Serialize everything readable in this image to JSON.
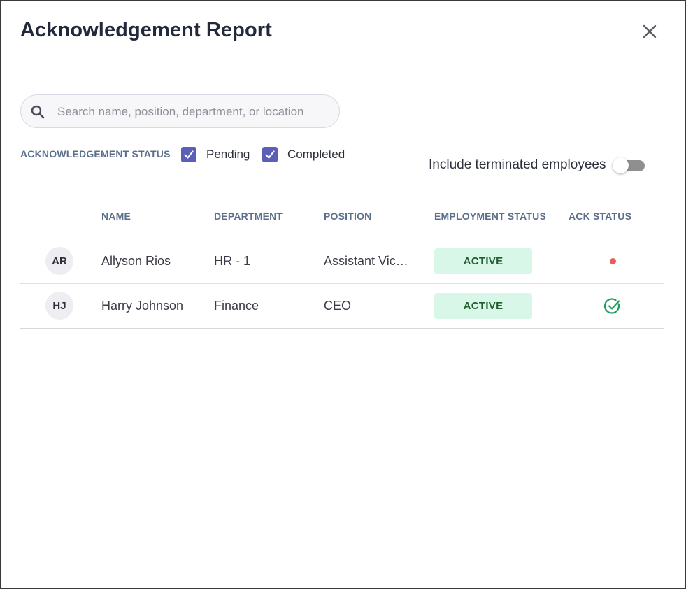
{
  "dialog": {
    "title": "Acknowledgement Report",
    "close_icon": "close-icon"
  },
  "search": {
    "icon": "search-icon",
    "placeholder": "Search name, position, department, or location",
    "value": ""
  },
  "filters": {
    "label": "ACKNOWLEDGEMENT STATUS",
    "pending": {
      "label": "Pending",
      "checked": true
    },
    "completed": {
      "label": "Completed",
      "checked": true
    },
    "terminated_toggle": {
      "label": "Include terminated employees",
      "on": false
    }
  },
  "table": {
    "columns": {
      "name": "NAME",
      "department": "DEPARTMENT",
      "position": "POSITION",
      "employment_status": "EMPLOYMENT STATUS",
      "ack_status": "ACK STATUS"
    },
    "rows": [
      {
        "initials": "AR",
        "name": "Allyson Rios",
        "department": "HR - 1",
        "position": "Assistant Vice…",
        "employment_status": "ACTIVE",
        "ack_status": "pending",
        "ack_icon": "red-dot-icon"
      },
      {
        "initials": "HJ",
        "name": "Harry Johnson",
        "department": "Finance",
        "position": "CEO",
        "employment_status": "ACTIVE",
        "ack_status": "completed",
        "ack_icon": "check-circle-icon"
      }
    ]
  },
  "colors": {
    "accent_checkbox": "#5b5fb8",
    "badge_bg": "#d9f7e8",
    "badge_text": "#1f5e2d",
    "pending_dot": "#ef5b5b",
    "completed_check": "#1e9e5e",
    "header_text": "#5c6f8a"
  }
}
